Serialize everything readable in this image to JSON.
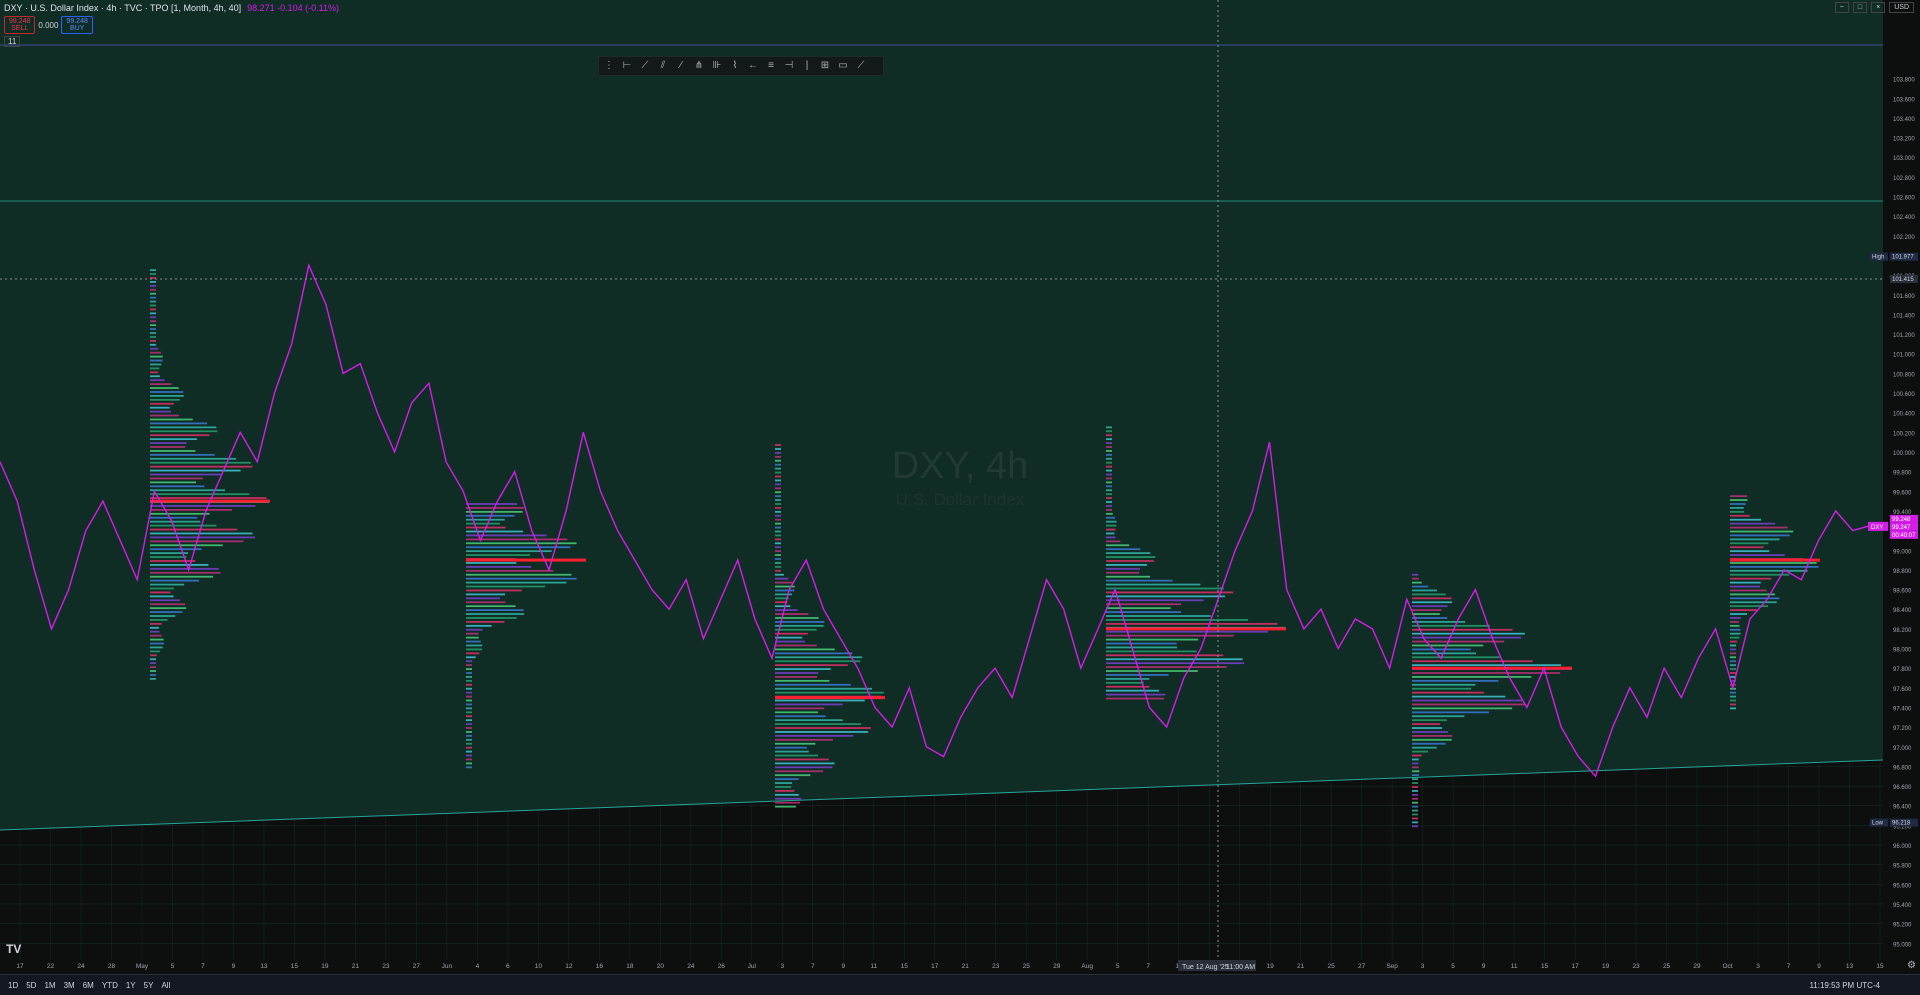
{
  "header": {
    "symbol_title": "DXY · U.S. Dollar Index · 4h · TVC · TPO [1, Month, 4h, 40]",
    "indicator_value": "98.271 -0.104 (-0.11%)",
    "sell_price": "99.248",
    "sell_label": "SELL",
    "spread": "0.000",
    "buy_price": "99.248",
    "buy_label": "BUY",
    "indicator_count": "11",
    "currency": "USD"
  },
  "watermark": {
    "title": "DXY, 4h",
    "subtitle": "U.S. Dollar Index"
  },
  "bottom_bar": {
    "timeframes": [
      "1D",
      "5D",
      "1M",
      "3M",
      "6M",
      "YTD",
      "1Y",
      "5Y",
      "All"
    ],
    "clock": "11:19:53 PM UTC-4"
  },
  "crosshair": {
    "date_label": "Tue 12 Aug '25",
    "time_label": "11:00 AM",
    "price_label": "101.415"
  },
  "colors": {
    "line": "#d41de8",
    "bg": "#0d2620",
    "channel": "#26a69a"
  },
  "chart_data": {
    "type": "line",
    "title": "DXY, 4h",
    "ylim": [
      94.83,
      104.6
    ],
    "price_ticks": [
      "103.800",
      "103.600",
      "103.400",
      "103.200",
      "103.000",
      "102.800",
      "102.600",
      "102.400",
      "102.200",
      "102.000",
      "101.800",
      "101.600",
      "101.400",
      "101.200",
      "101.000",
      "100.800",
      "100.600",
      "100.400",
      "100.200",
      "100.000",
      "99.800",
      "99.600",
      "99.400",
      "99.200",
      "99.000",
      "98.800",
      "98.600",
      "98.400",
      "98.200",
      "98.000",
      "97.800",
      "97.600",
      "97.400",
      "97.200",
      "97.000",
      "96.800",
      "96.600",
      "96.400",
      "96.200",
      "96.000",
      "95.800",
      "95.600",
      "95.400",
      "95.200",
      "95.000"
    ],
    "date_ticks": [
      "17",
      "22",
      "24",
      "28",
      "May",
      "5",
      "7",
      "9",
      "13",
      "15",
      "19",
      "21",
      "23",
      "27",
      "Jun",
      "4",
      "6",
      "10",
      "12",
      "16",
      "18",
      "20",
      "24",
      "26",
      "Jul",
      "3",
      "7",
      "9",
      "11",
      "15",
      "17",
      "21",
      "23",
      "25",
      "29",
      "Aug",
      "5",
      "7",
      "11",
      "13",
      "15",
      "19",
      "21",
      "25",
      "27",
      "Sep",
      "3",
      "5",
      "9",
      "11",
      "15",
      "17",
      "19",
      "23",
      "25",
      "29",
      "Oct",
      "3",
      "7",
      "9",
      "13",
      "15"
    ],
    "price_labels": [
      {
        "name": "High",
        "value": "101.977"
      },
      {
        "name": "",
        "value": "99.248"
      },
      {
        "name": "",
        "value": "99.247"
      },
      {
        "name": "",
        "value": "00:40:07"
      },
      {
        "name": "Low",
        "value": "96.218"
      }
    ],
    "symbol_label": "DXY",
    "series": [
      {
        "name": "DXY",
        "values": [
          99.9,
          99.5,
          98.8,
          98.2,
          98.6,
          99.2,
          99.5,
          99.1,
          98.7,
          99.6,
          99.3,
          98.8,
          99.4,
          99.8,
          100.2,
          99.9,
          100.6,
          101.1,
          101.9,
          101.5,
          100.8,
          100.9,
          100.4,
          100.0,
          100.5,
          100.7,
          99.9,
          99.6,
          99.1,
          99.5,
          99.8,
          99.2,
          98.8,
          99.4,
          100.2,
          99.6,
          99.2,
          98.9,
          98.6,
          98.4,
          98.7,
          98.1,
          98.5,
          98.9,
          98.3,
          97.9,
          98.6,
          98.9,
          98.4,
          98.1,
          97.8,
          97.4,
          97.2,
          97.6,
          97.0,
          96.9,
          97.3,
          97.6,
          97.8,
          97.5,
          98.1,
          98.7,
          98.4,
          97.8,
          98.2,
          98.6,
          98.0,
          97.4,
          97.2,
          97.7,
          98.0,
          98.5,
          99.0,
          99.4,
          100.1,
          98.6,
          98.2,
          98.4,
          98.0,
          98.3,
          98.2,
          97.8,
          98.5,
          98.1,
          97.9,
          98.3,
          98.6,
          98.1,
          97.7,
          97.4,
          97.8,
          97.2,
          96.9,
          96.7,
          97.2,
          97.6,
          97.3,
          97.8,
          97.5,
          97.9,
          98.2,
          97.6,
          98.3,
          98.5,
          98.8,
          98.7,
          99.1,
          99.4,
          99.2,
          99.25
        ]
      }
    ],
    "levels": [
      {
        "name": "POC",
        "value": 99.49
      },
      {
        "name": "VAH",
        "value": 99.58
      }
    ]
  }
}
